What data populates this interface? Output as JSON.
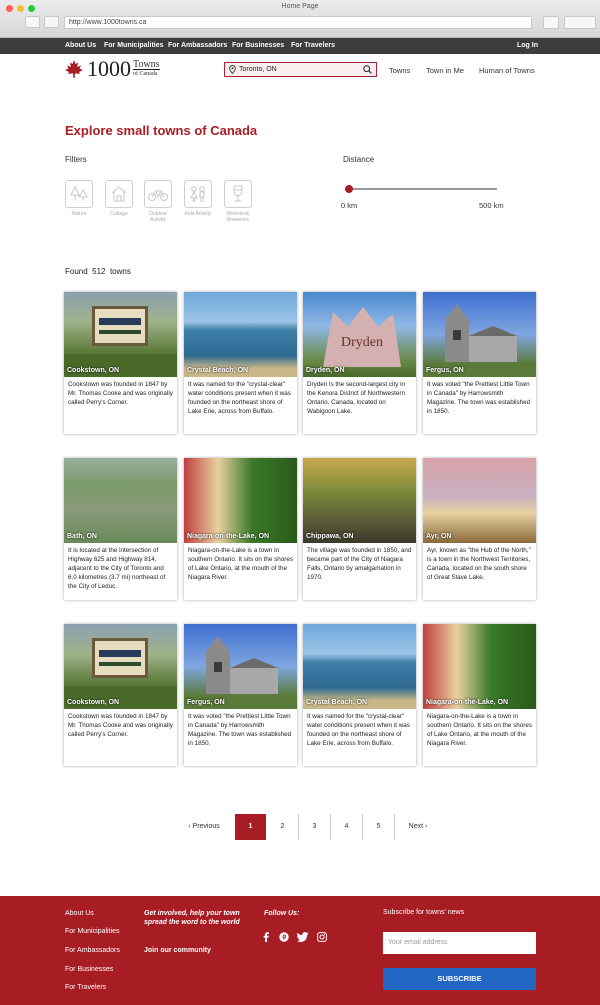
{
  "window": {
    "title": "Home Page",
    "url": "http://www.1000towns.ca"
  },
  "topbar": {
    "links": [
      "About Us",
      "For Municipalities",
      "For Ambassadors",
      "For Businesses",
      "For Travelers"
    ],
    "login": "Log In"
  },
  "header": {
    "logo_number": "1000",
    "logo_towns": "Towns",
    "logo_of_canada": "of Canada",
    "search_value": "Toronto, ON",
    "nav": [
      "Towns",
      "Town in Me",
      "Human of Towns"
    ]
  },
  "main": {
    "title": "Explore small towns of Canada",
    "filters_label": "Filters",
    "distance_label": "Distance",
    "filters": [
      {
        "label": "Nature",
        "icon": "trees-icon"
      },
      {
        "label": "Cottage",
        "icon": "cottage-icon"
      },
      {
        "label": "Outdoor Activity",
        "icon": "bicycle-icon"
      },
      {
        "label": "Kids Activity",
        "icon": "kids-icon"
      },
      {
        "label": "Wineries& Breweries",
        "icon": "wine-glass-icon"
      }
    ],
    "distance": {
      "min": "0 km",
      "max": "500 km",
      "value_fraction": 0
    },
    "found": {
      "prefix": "Found",
      "count": "512",
      "suffix": "towns"
    }
  },
  "cards": [
    {
      "name": "Cookstown, ON",
      "desc": "Cookstown was founded in 1847 by Mr. Thomas Cooke and was originally called Perry's Corner."
    },
    {
      "name": "Crystal Beach, ON",
      "desc": " It was named for the \"crystal-clear\" water conditions present when it was founded on the northeast shore of Lake Erie, across from Buffalo."
    },
    {
      "name": "Dryden, ON",
      "desc": "Dryden is the second-largest city in the Kenora District of Northwestern Ontario, Canada, located on Wabigoon Lake."
    },
    {
      "name": "Fergus, ON",
      "desc": "It was voted \"the Prettiest Little Town in Canada\" by Harrowsmith Magazine. The town was established in 1850."
    },
    {
      "name": "Bath, ON",
      "desc": "It is located at the intersection of Highway 625 and Highway 814, adjacent to the City of Toronto and 6.0 kilometres (3.7 mi) northeast of the City of Leduc."
    },
    {
      "name": "Niagara-on-the-Lake, ON",
      "desc": "Niagara-on-the-Lake is a town in southern Ontario. It sits on the shores of Lake Ontario, at the mouth of the Niagara River."
    },
    {
      "name": "Chippawa, ON",
      "desc": "The village was founded in 1850, and became part of the City of Niagara Falls, Ontario by amalgamation in 1970."
    },
    {
      "name": "Ayr, ON",
      "desc": "Ayr, known as \"the Hub of the North,\" is a town in the Northwest Territories, Canada, located on the south shore of Great Slave Lake."
    },
    {
      "name": "Cookstown, ON",
      "desc": "Cookstown was founded in 1847 by Mr. Thomas Cooke and was originally called Perry's Corner."
    },
    {
      "name": "Fergus, ON",
      "desc": "It was voted \"the Prettiest Little Town in Canada\" by Harrowsmith Magazine. The town was established in 1850."
    },
    {
      "name": "Crystal Beach, ON",
      "desc": " It was named for the \"crystal-clear\" water conditions present when it was founded on the northeast shore of Lake Erie, across from Buffalo."
    },
    {
      "name": "Niagara-on-the-Lake, ON",
      "desc": "Niagara-on-the-Lake is a town in southern Ontario. It sits on the shores of Lake Ontario, at the mouth of the Niagara River."
    }
  ],
  "pagination": {
    "previous": "Previous",
    "pages": [
      "1",
      "2",
      "3",
      "4",
      "5"
    ],
    "next": "Next",
    "current": "1"
  },
  "footer": {
    "links": [
      "About Us",
      "For Municipalities",
      "For Ambassadors",
      "For Businesses",
      "For Travelers"
    ],
    "cta": "Get involved, help your town spread the word to the world",
    "join": "Join our community",
    "follow": "Follow Us:",
    "subscribe_title": "Subscribe for towns' news",
    "email_placeholder": "Your email address",
    "subscribe_button": "SUBSCRIBE",
    "social_icons": [
      "facebook-icon",
      "pinterest-icon",
      "twitter-icon",
      "instagram-icon"
    ]
  },
  "colors": {
    "brand_red": "#a81d24",
    "dark_bar": "#3d3d3d",
    "subscribe_blue": "#2266c4"
  }
}
